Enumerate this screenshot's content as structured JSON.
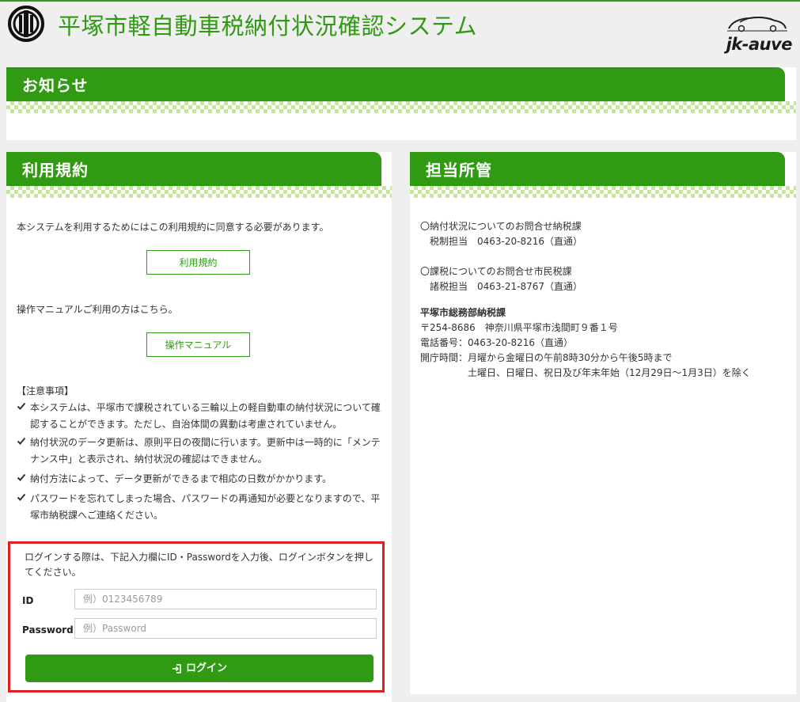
{
  "header": {
    "title": "平塚市軽自動車税納付状況確認システム",
    "brand": "jk-auve",
    "accent": "#2f9a12"
  },
  "notice": {
    "title": "お知らせ"
  },
  "terms": {
    "title": "利用規約",
    "intro": "本システムを利用するためにはこの利用規約に同意する必要があります。",
    "terms_button": "利用規約",
    "manual_intro": "操作マニュアルご利用の方はこちら。",
    "manual_button": "操作マニュアル",
    "notes_heading": "【注意事項】",
    "notes": [
      "本システムは、平塚市で課税されている三輪以上の軽自動車の納付状況について確認することができます。ただし、自治体間の異動は考慮されていません。",
      "納付状況のデータ更新は、原則平日の夜間に行います。更新中は一時的に「メンテナンス中」と表示され、納付状況の確認はできません。",
      "納付方法によって、データ更新ができるまで相応の日数がかかります。",
      "パスワードを忘れてしまった場合、パスワードの再通知が必要となりますので、平塚市納税課へご連絡ください。"
    ]
  },
  "login": {
    "message": "ログインする際は、下記入力欄にID・Passwordを入力後、ログインボタンを押してください。",
    "id_label": "ID",
    "id_placeholder": "例）0123456789",
    "password_label": "Password",
    "password_placeholder": "例）Password",
    "button": "ログイン"
  },
  "contact": {
    "title": "担当所管",
    "payment_inquiry": "〇納付状況についてのお問合せ納税課",
    "payment_line": "税制担当　0463-20-8216（直通）",
    "tax_inquiry": "〇課税についてのお問合せ市民税課",
    "tax_line": "諸税担当　0463-21-8767（直通）",
    "dept": "平塚市総務部納税課",
    "address": "〒254-8686　神奈川県平塚市浅間町９番１号",
    "phone": "電話番号：0463-20-8216（直通）",
    "hours": "開庁時間：月曜から金曜日の午前8時30分から午後5時まで",
    "hours_note": "土曜日、日曜日、祝日及び年末年始（12月29日～1月3日）を除く"
  }
}
